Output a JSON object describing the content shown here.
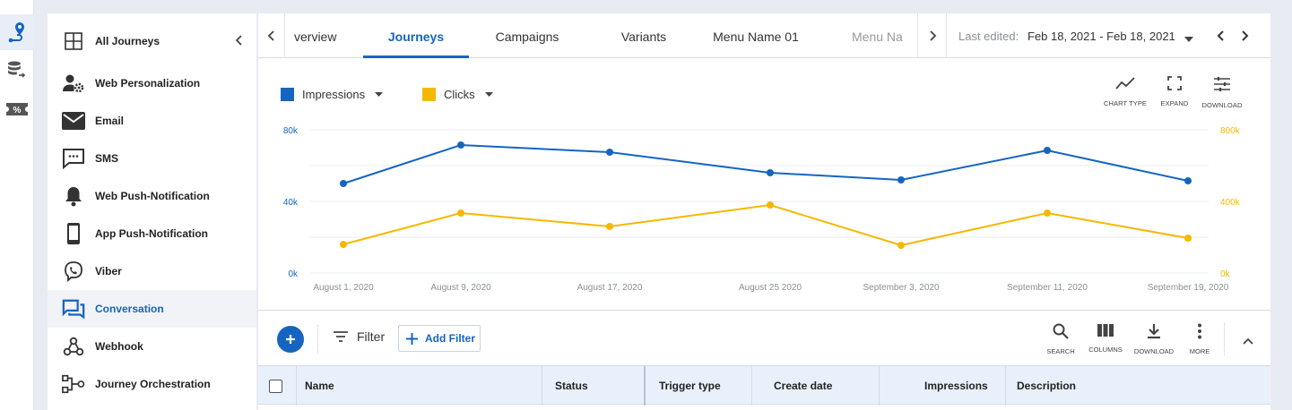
{
  "rail": {
    "items": [
      {
        "icon": "journey-pin-icon"
      },
      {
        "icon": "database-export-icon"
      },
      {
        "icon": "coupon-icon",
        "text": "%"
      }
    ]
  },
  "sidebar": {
    "header": {
      "label": "All Journeys",
      "icon": "grid-icon"
    },
    "items": [
      {
        "label": "Web Personalization",
        "icon": "user-gear-icon"
      },
      {
        "label": "Email",
        "icon": "email-icon"
      },
      {
        "label": "SMS",
        "icon": "sms-icon"
      },
      {
        "label": "Web Push-Notification",
        "icon": "bell-icon"
      },
      {
        "label": "App Push-Notification",
        "icon": "mobile-icon"
      },
      {
        "label": "Viber",
        "icon": "viber-icon"
      },
      {
        "label": "Conversation",
        "icon": "conversation-icon",
        "active": true
      },
      {
        "label": "Webhook",
        "icon": "webhook-icon"
      },
      {
        "label": "Journey Orchestration",
        "icon": "orchestration-icon"
      }
    ]
  },
  "tabs": [
    {
      "label": "verview"
    },
    {
      "label": "Journeys",
      "active": true
    },
    {
      "label": "Campaigns"
    },
    {
      "label": "Variants"
    },
    {
      "label": "Menu Name 01"
    },
    {
      "label": "Menu Na"
    }
  ],
  "date_range": {
    "label": "Last edited:",
    "value": "Feb 18, 2021  -  Feb 18, 2021"
  },
  "chart_toolbar": {
    "chart_type": "CHART TYPE",
    "expand": "EXPAND",
    "download": "DOWNLOAD"
  },
  "chart_data": {
    "type": "line",
    "x": [
      "August 1, 2020",
      "August 9, 2020",
      "August 17, 2020",
      "August 25 2020",
      "September 3, 2020",
      "September 11, 2020",
      "September 19, 2020"
    ],
    "series": [
      {
        "name": "Impressions",
        "axis": "left",
        "color": "#1565c0",
        "values": [
          50000,
          71500,
          67500,
          56000,
          52000,
          68500,
          51500
        ]
      },
      {
        "name": "Clicks",
        "axis": "right",
        "color": "#f5b800",
        "values": [
          160000,
          335000,
          260000,
          380000,
          155000,
          335000,
          195000
        ]
      }
    ],
    "y_left": {
      "ticks": [
        "80k",
        "40k",
        "0k"
      ],
      "range": [
        0,
        80000
      ],
      "color": "#1565c0"
    },
    "y_right": {
      "ticks": [
        "800k",
        "400k",
        "0k"
      ],
      "range": [
        0,
        800000
      ],
      "color": "#f5b800"
    },
    "grid": true
  },
  "filterbar": {
    "filter_label": "Filter",
    "add_filter_label": "Add Filter",
    "tools": {
      "search": "SEARCH",
      "columns": "COLUMNS",
      "download": "DOWNLOAD",
      "more": "MORE"
    }
  },
  "table": {
    "columns": [
      "Name",
      "Status",
      "Trigger type",
      "Create date",
      "Impressions",
      "Description"
    ]
  }
}
